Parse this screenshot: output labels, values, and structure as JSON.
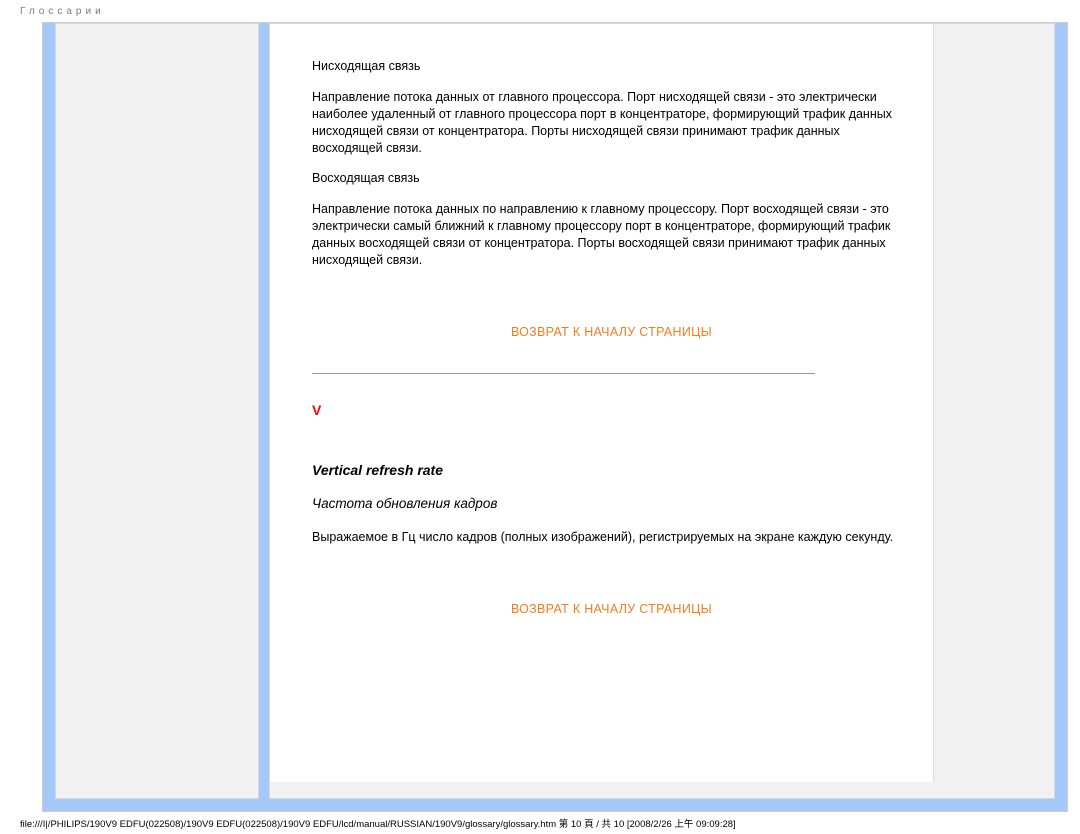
{
  "header": {
    "title": "Глоссарии"
  },
  "body": {
    "sub1_title": "Нисходящая связь",
    "sub1_text": "Направление потока данных от главного процессора. Порт нисходящей связи - это электрически наиболее удаленный от главного процессора порт в концентраторе, формирующий трафик данных нисходящей связи от концентратора. Порты нисходящей связи принимают трафик данных восходящей связи.",
    "sub2_title": "Восходящая связь",
    "sub2_text": "Направление потока данных по направлению к главному процессору. Порт восходящей связи - это электрически самый ближний к главному процессору порт в концентраторе, формирующий трафик данных восходящей связи от концентратора. Порты восходящей связи принимают трафик данных нисходящей связи.",
    "return_label": "ВОЗВРАТ К НАЧАЛУ СТРАНИЦЫ",
    "letter": "V",
    "term_en": "Vertical refresh rate",
    "term_ru": "Частота обновления кадров",
    "term_def": "Выражаемое в Гц число кадров (полных изображений), регистрируемых на экране каждую секунду."
  },
  "footer": {
    "path": "file:///I|/PHILIPS/190V9 EDFU(022508)/190V9 EDFU(022508)/190V9 EDFU/lcd/manual/RUSSIAN/190V9/glossary/glossary.htm 第 10 頁 / 共 10  [2008/2/26 上午 09:09:28]"
  }
}
